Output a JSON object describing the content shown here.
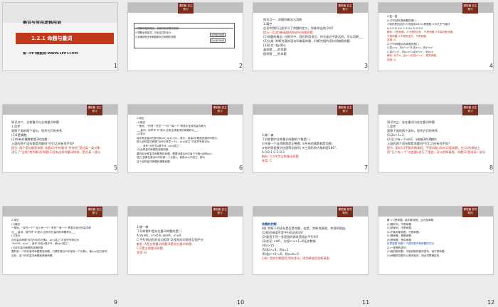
{
  "slides": [
    {
      "num": "1",
      "title": "集合与常用逻辑用语",
      "band": "1.2.1  命题与量词",
      "footer": "第一PPT模板网-WWW.1PPT.COM"
    },
    {
      "num": "2",
      "badge": "课前篇 自主预习",
      "rows": [
        "1.理解命题的概念，并能判断命题的真假.",
        "2.理解全称量词、存在量词的含义.",
        "3.准确判断全称命题和存在命题的真假",
        "全称量词命题",
        "存在量词命题"
      ]
    },
    {
      "num": "3",
      "badge": "课前篇 自主预习",
      "lines": [
        "知识点一、命题的概念与判断",
        "1.填空",
        "  在初中我们已经学习了命题的定义，你能举出例子吗?",
        "  提示: 可以判断真假的陈述句叫做命题.",
        "  (1)命题的概念: 在数学中，我们把用语言、符号或式子表达的，可以判断___的____叫做命题.",
        "  (2)分类: 判断为真的语句叫做真命题，判断为假的语句叫做假命题.",
        "  (3)形式: 若p则q",
        "  真命题 ___的命题",
        "  假命题 ___的命题"
      ]
    },
    {
      "num": "4",
      "badge": "课前篇 自主预习",
      "lines": [
        "2.做一做",
        "  (1)下列语句是命题的是(    )",
        "  ①梯形是四边形;②作直线AB;③x是整数;④今天天气真好",
        "  A.①②    B.①④    C.①③④    D.①②③",
        "  解析: ①是命题，②不是陈述句，不是命题;③不能判断真假,",
        "  不是命题;④不是陈述句，不是命题.",
        "  答案: A",
        "  (2)下列命题为真命题的是(    )",
        "  A.若x=y，则x²=y²    B.若x>y，则x²>y²",
        "  C.若x²=y²，则x=y    D.若x²<y²，则x<y",
        "  解析: 对于A，由x=y可知x²=y²，是真命题.",
        "  答案: A"
      ]
    },
    {
      "num": "5",
      "badge": "课前篇 自主预习",
      "lines": [
        "知识点二、全称量词与全称量词命题",
        "1.思考",
        "  观察下面的两个语句，思考它们的关系:",
        "  (1)3是偶数;",
        "  (2)所有的偶数都是2的倍数;",
        "  上面的两个语句都是命题吗?它们之间有何不同?",
        "  提示: 两个语句都是命题. 命题(2)中的量词“所有的”是对某一类对象",
        "  进行了“全称”的判断;而命题(1)没有这样的量词修饰，是对某一部分."
      ]
    },
    {
      "num": "6",
      "badge": "课前篇 自主预习",
      "lines": [
        "2.填空",
        "  (1)概念",
        "  一般地，“所有”“任意”“一切”“每一个”等表示全体的量词称为",
        "  ___量词，用符号“∀”表示;含有全称量词的命题称为___.",
        "  (2)表示",
        "  将含有变量x的语句用p(x),q(x),r(x)...表示，变量x的取值范围用M表示，",
        "  那么全称量词命题“对M中任意一个x，p(x)成立”可用符号简记为",
        "  ___，读作“对任意x属于M，p(x)成立”.",
        "  (3)全称量词命题的真假判断",
        "  要判定全称量词命题是真命题，需要对集合M中每个元素x证明p(x)",
        "  成立;如果在集合M中找到一个元素x，使得p(x)不成立，那么",
        "  这个全称量词命题就是假命题."
      ]
    },
    {
      "num": "7",
      "badge": "课前篇 自主预习",
      "lines": [
        "3.做一做",
        "  下列命题中全称量词命题的个数是(    )",
        "  ①任意一个自然数都是正整数;  ②所有的素数都是奇数;",
        "  ③有的等差数列也是等比数列;  ④三角形的内角和是180°.",
        "  A.0    B.1    C.2    D.3",
        "  解析: ①②④为全称量词命题.",
        "  答案: C"
      ]
    },
    {
      "num": "8",
      "badge": "课前篇 自主预习",
      "lines": [
        "知识点三、存在量词与存在量词命题",
        "1.思考",
        "  观察下面的两个语句，思考它们的关系:",
        "  (1)2x+1=3;",
        "  (2)至少有一个x∈Z，x能被2和3整除;",
        "  上面的两个语句都是命题吗?它们之间有何不同?",
        "  提示: 语句(1)不能判断真假，不是命题.语句(2)是命题，在(1)的基础上",
        "  用“至少有一个”对变量x进行了限定，可以判断真假，命题(2)是对某一部分."
      ]
    },
    {
      "num": "9",
      "badge": "课前篇 自主预习",
      "lines": [
        "2.填空",
        "  (1)概念",
        "  一般地，“存在一个”“至少有一个”“有些”“有一个”等表示部分的量词称",
        "  为___量词，用符号“∃”表示;含有存在量词的命题称为___.",
        "  (2)表示",
        "  存在量词命题“存在M中的元素x，p(x)成立”可用符号简记为",
        "  “∃x∈M，p(x)”，读作“存在x属于M，使p(x)成立”.",
        "  (3)存在量词命题的真假判断",
        "  要判定一个存在量词命题是真命题，只需在集合M中找到一个元素x，使p(x)成立即可;",
        "  否则，这个存在量词命题就是假命题."
      ]
    },
    {
      "num": "10",
      "badge": "课前篇 自主预习",
      "lines": [
        "3.做一做",
        "  下列命题中是存在量词命题的是(    )",
        "  A.∀x∈R，x²>0        B.∃x∈R，x²≤0",
        "  C.平行四边形的对边相等    D.矩形的对角线互相平分",
        "  解析: A是全称量词命题;B是存在量词命题;",
        "  C,D是全称量词命题.",
        "  答案: B"
      ]
    },
    {
      "num": "11",
      "badge": "课堂篇 探究新知",
      "lines": [
        "命题的判断",
        "例1 判断下列语句是否是命题，若是，判断其真假，并说明理由.",
        "  (1)矩形难道不是平行四边形吗?",
        "  (2)垂直于同一条直线的两条直线必平行吗?",
        "  (3)求证: x∈R，方程x²-x+1=0无实数根.",
        "  (4)x>15.",
        "  (5)若x²=4，则x=2.",
        "  (6)若a²+b²=0，则a=b=0.",
        "  分析: 首先判断是否为陈述句，再判断能否判断真假."
      ]
    },
    {
      "num": "12",
      "badge": "课堂篇 探究新知",
      "lines": [
        "解: (1)是命题，能判断真假，且为真命题.",
        "  (2)疑问句，不是命题.",
        "  (3)祈使句，不是命题.",
        "  (4)不能判断真假，不是命题.",
        "  (5)是命题，是假命题.",
        "  (6)是命题，是真命题.",
        "  反思感悟 判断一个语句是不是命题的方法:",
        "  (1)一般是陈述句;",
        "  (2)能判断真假，不能判断真假的语句，就不是命题.",
        "  (3)命题的真假可以是未知的，但必须是确定的."
      ]
    }
  ]
}
